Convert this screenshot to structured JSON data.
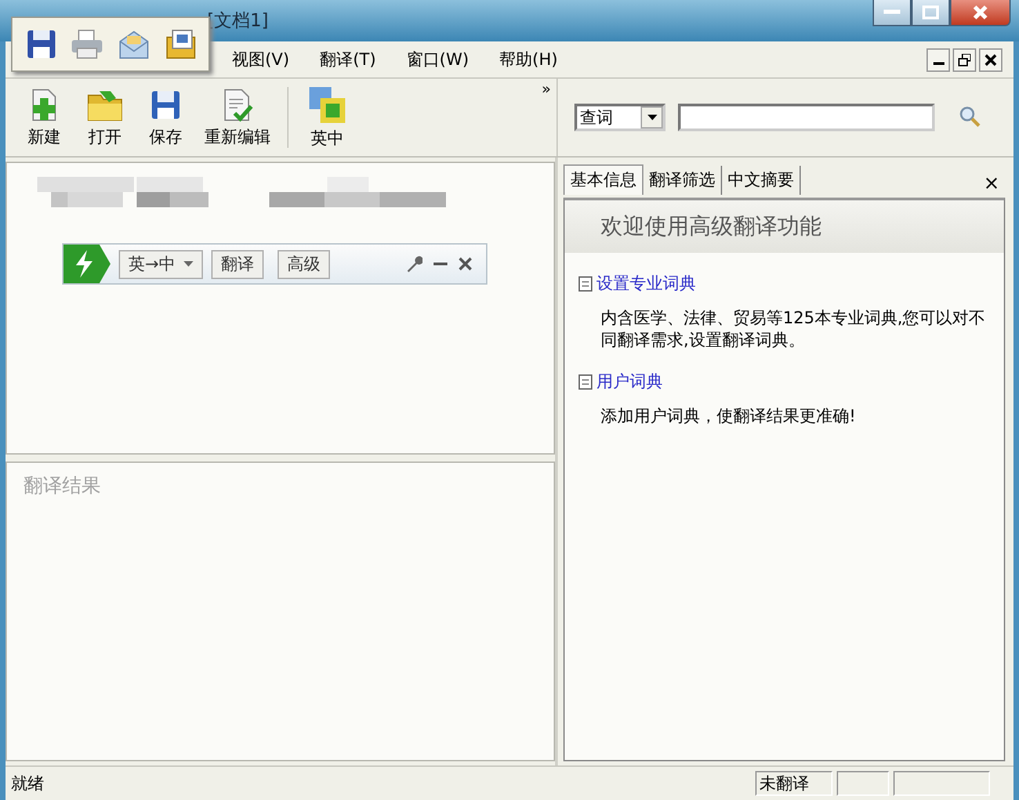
{
  "window": {
    "title": "[文档1]"
  },
  "menu": [
    "视图(V)",
    "翻译(T)",
    "窗口(W)",
    "帮助(H)"
  ],
  "toolbar": {
    "buttons": [
      {
        "label": "新建"
      },
      {
        "label": "打开"
      },
      {
        "label": "保存"
      },
      {
        "label": "重新编辑"
      },
      {
        "label": "英中"
      }
    ],
    "overflow": "»"
  },
  "search": {
    "mode": "查词"
  },
  "mini_bar": {
    "direction": "英→中",
    "buttons": [
      "翻译",
      "高级"
    ]
  },
  "result_pane": {
    "placeholder": "翻译结果"
  },
  "side_panel": {
    "tabs": [
      {
        "label": "基本信息",
        "selected": true
      },
      {
        "label": "翻译筛选",
        "selected": false
      },
      {
        "label": "中文摘要",
        "selected": false
      }
    ],
    "close": "×",
    "heading": "欢迎使用高级翻译功能",
    "sections": [
      {
        "link": "设置专业词典",
        "text": "内含医学、法律、贸易等125本专业词典,您可以对不同翻译需求,设置翻译词典。"
      },
      {
        "link": "用户词典",
        "text": "添加用户词典，使翻译结果更准确!"
      }
    ]
  },
  "status_bar": {
    "message": "就绪",
    "panes": [
      "未翻译"
    ]
  }
}
